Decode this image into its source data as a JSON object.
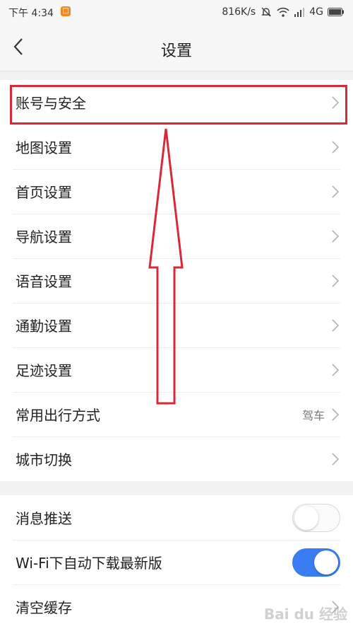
{
  "status_bar": {
    "time": "下午 4:34",
    "net_speed": "816K/s",
    "network": "4G",
    "notification_icon": "app-notification-icon"
  },
  "header": {
    "title": "设置",
    "back_icon": "chevron-left-icon"
  },
  "settings": [
    {
      "label": "账号与安全",
      "value": ""
    },
    {
      "label": "地图设置",
      "value": ""
    },
    {
      "label": "首页设置",
      "value": ""
    },
    {
      "label": "导航设置",
      "value": ""
    },
    {
      "label": "语音设置",
      "value": ""
    },
    {
      "label": "通勤设置",
      "value": ""
    },
    {
      "label": "足迹设置",
      "value": ""
    },
    {
      "label": "常用出行方式",
      "value": "驾车"
    },
    {
      "label": "城市切换",
      "value": ""
    }
  ],
  "toggles": [
    {
      "label": "消息推送",
      "on": false
    },
    {
      "label": "Wi-Fi下自动下载最新版",
      "on": true
    }
  ],
  "cache": {
    "label": "清空缓存"
  },
  "colors": {
    "annotation_red": "#d62a3a",
    "toggle_on": "#3a7cf2"
  },
  "watermark": "Bai du 经验"
}
